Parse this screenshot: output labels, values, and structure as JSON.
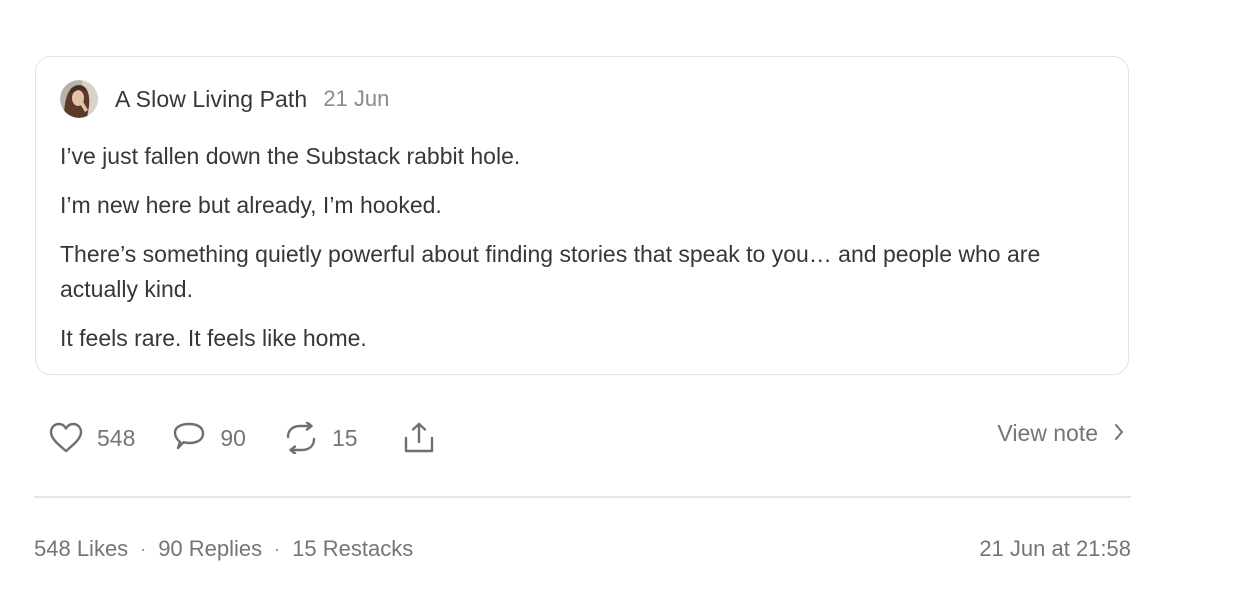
{
  "note": {
    "author": "A Slow Living Path",
    "date": "21 Jun",
    "paragraphs": [
      "I’ve just fallen down the Substack rabbit hole.",
      "I’m new here but already, I’m hooked.",
      "There’s something quietly powerful about finding stories that speak to you… and people who are actually kind.",
      "It feels rare. It feels like home."
    ]
  },
  "actions": {
    "likes": "548",
    "replies": "90",
    "restacks": "15",
    "like_icon": "heart-icon",
    "reply_icon": "speech-bubble-icon",
    "restack_icon": "restack-icon",
    "share_icon": "share-icon",
    "view_note_label": "View note"
  },
  "stats": {
    "likes_label": "548 Likes",
    "replies_label": "90 Replies",
    "restacks_label": "15 Restacks",
    "separator": "·",
    "timestamp": "21 Jun at 21:58"
  },
  "colors": {
    "text": "#363737",
    "muted": "#757575",
    "border": "#e3e3e3"
  }
}
